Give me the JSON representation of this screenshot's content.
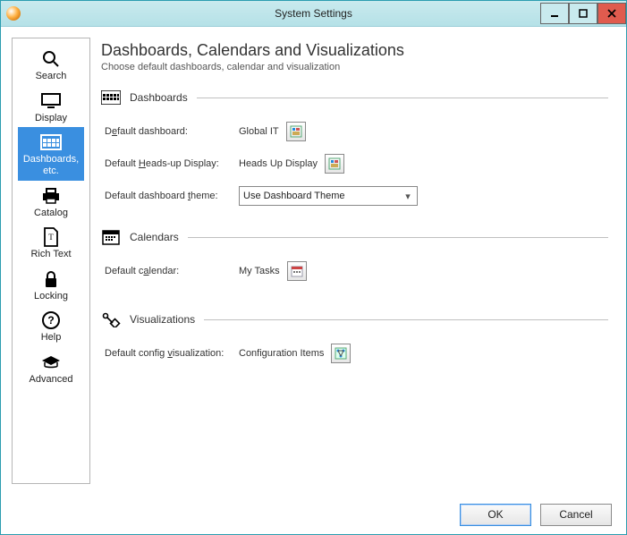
{
  "window": {
    "title": "System Settings"
  },
  "sidebar": {
    "items": [
      {
        "label": "Search"
      },
      {
        "label": "Display"
      },
      {
        "label": "Dashboards, etc."
      },
      {
        "label": "Catalog"
      },
      {
        "label": "Rich Text"
      },
      {
        "label": "Locking"
      },
      {
        "label": "Help"
      },
      {
        "label": "Advanced"
      }
    ]
  },
  "main": {
    "heading": "Dashboards, Calendars and Visualizations",
    "subtitle": "Choose default dashboards, calendar and visualization",
    "sections": {
      "dashboards": {
        "title": "Dashboards",
        "rows": {
          "default_dashboard": {
            "label_pre": "D",
            "label_ul": "e",
            "label_post": "fault dashboard:",
            "value": "Global IT"
          },
          "default_hud": {
            "label_pre": "Default ",
            "label_ul": "H",
            "label_post": "eads-up Display:",
            "value": "Heads Up Display"
          },
          "default_theme": {
            "label_pre": "Default dashboard ",
            "label_ul": "t",
            "label_post": "heme:",
            "value": "Use Dashboard Theme"
          }
        }
      },
      "calendars": {
        "title": "Calendars",
        "rows": {
          "default_calendar": {
            "label_pre": "Default c",
            "label_ul": "a",
            "label_post": "lendar:",
            "value": "My Tasks"
          }
        }
      },
      "visualizations": {
        "title": "Visualizations",
        "rows": {
          "default_config_viz": {
            "label_pre": "Default config ",
            "label_ul": "v",
            "label_post": "isualization:",
            "value": "Configuration Items"
          }
        }
      }
    }
  },
  "footer": {
    "ok": "OK",
    "cancel": "Cancel"
  }
}
